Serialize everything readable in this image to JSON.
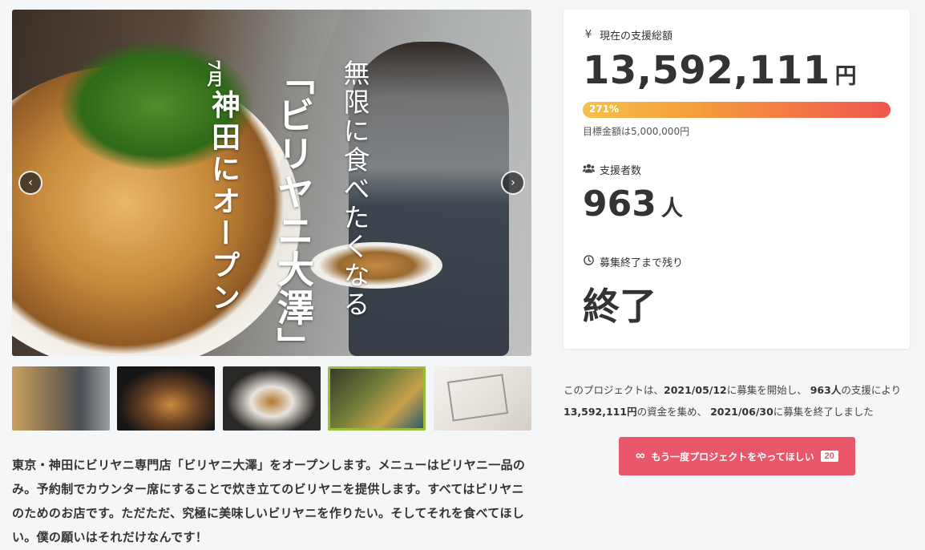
{
  "hero": {
    "month": "7月",
    "open_text": "神田にオープン",
    "shop_name": "「ビリヤニ大澤」",
    "copy": "無限に食べたくなる",
    "prev_symbol": "‹",
    "next_symbol": "›"
  },
  "thumbnails": [
    "thumb-1",
    "thumb-2",
    "thumb-3",
    "thumb-4",
    "thumb-5"
  ],
  "description": "東京・神田にビリヤニ専門店「ビリヤニ大澤」をオープンします。メニューはビリヤニ一品のみ。予約制でカウンター席にすることで炊き立てのビリヤニを提供します。すべてはビリヤニのためのお店です。ただただ、究極に美味しいビリヤニを作りたい。そしてそれを食べてほしい。僕の願いはそれだけなんです！",
  "stats": {
    "amount_label": "現在の支援総額",
    "amount_icon": "¥",
    "amount_value": "13,592,111",
    "amount_unit": "円",
    "progress_percent": 271,
    "progress_label": "271%",
    "goal_text": "目標金額は5,000,000円",
    "backers_label": "支援者数",
    "backers_value": "963",
    "backers_unit": "人",
    "remaining_label": "募集終了まで残り",
    "remaining_value": "終了"
  },
  "summary": {
    "prefix": "このプロジェクトは、",
    "start_date": "2021/05/12",
    "mid1": "に募集を開始し、",
    "backers": "963人",
    "mid2": "の支援により",
    "amount": "13,592,111円",
    "mid3": "の資金を集め、",
    "end_date": "2021/06/30",
    "suffix": "に募集を終了しました"
  },
  "again_button": {
    "icon": "∞",
    "label": "もう一度プロジェクトをやってほしい",
    "count": "20"
  },
  "colors": {
    "accent": "#e9586a",
    "progress_start": "#f5c24a",
    "progress_end": "#f0564e"
  }
}
